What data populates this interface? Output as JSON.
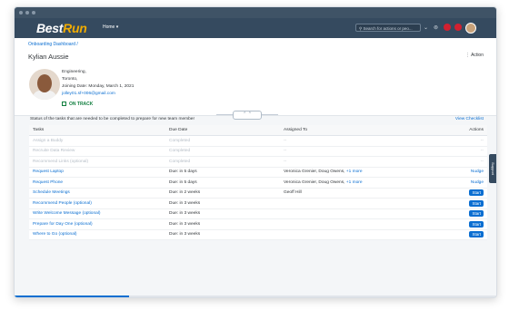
{
  "shell": {
    "logo_main": "Best",
    "logo_accent": "Run",
    "home_label": "Home ▾",
    "search_placeholder": "Search for actions or peo..."
  },
  "header": {
    "breadcrumb": "Onboarding Dashboard /",
    "title": "Kylian Aussie",
    "action_label": "⋮  Action",
    "department": "Engineering,",
    "location": "Toronto,",
    "joining": "Joining Date: Monday, March 1, 2021",
    "email": "jolley01.sf+006@gmail.com",
    "status": "ON TRACK"
  },
  "tasks_section": {
    "status_text": "Status of the tasks that are needed to be completed to prepare for new team member",
    "view_checklist": "View Checklist",
    "columns": [
      "Tasks",
      "Due Date",
      "Assigned To",
      "Actions"
    ],
    "rows": [
      {
        "task": "Assign a Buddy",
        "due": "Completed",
        "assigned": "--",
        "more": "",
        "action": "--",
        "state": "done"
      },
      {
        "task": "Recruite Data Review",
        "due": "Completed",
        "assigned": "--",
        "more": "",
        "action": "--",
        "state": "done"
      },
      {
        "task": "Recommend Links (optional)",
        "due": "Completed",
        "assigned": "--",
        "more": "",
        "action": "--",
        "state": "done"
      },
      {
        "task": "Request Laptop",
        "due": "Due: in 5 days",
        "assigned": "Veronica Grenier, Doug Owens, ",
        "more": "+1 more",
        "action": "Nudge",
        "state": "nudge"
      },
      {
        "task": "Request Phone",
        "due": "Due: in 5 days",
        "assigned": "Veronica Grenier, Doug Owens, ",
        "more": "+1 more",
        "action": "Nudge",
        "state": "nudge"
      },
      {
        "task": "Schedule Meetings",
        "due": "Due: in 2 weeks",
        "assigned": "Geoff Hill",
        "more": "",
        "action": "Start",
        "state": "start"
      },
      {
        "task": "Recommend People (optional)",
        "due": "Due: in 3 weeks",
        "assigned": "",
        "more": "",
        "action": "Start",
        "state": "start"
      },
      {
        "task": "Write Welcome Message (optional)",
        "due": "Due: in 3 weeks",
        "assigned": "",
        "more": "",
        "action": "Start",
        "state": "start"
      },
      {
        "task": "Prepare for Day One (optional)",
        "due": "Due: in 3 weeks",
        "assigned": "",
        "more": "",
        "action": "Start",
        "state": "start"
      },
      {
        "task": "Where to Go (optional)",
        "due": "Due: in 3 weeks",
        "assigned": "",
        "more": "",
        "action": "Start",
        "state": "start"
      }
    ]
  },
  "support_label": "Support",
  "colors": {
    "shell": "#354a5f",
    "link": "#0a6ed1",
    "on_track": "#107e3e",
    "logo_accent": "#f0ab00"
  }
}
